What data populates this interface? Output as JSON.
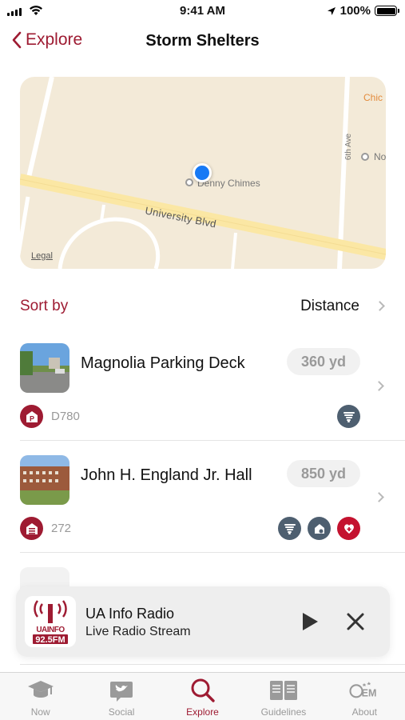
{
  "status_bar": {
    "time": "9:41 AM",
    "battery": "100%"
  },
  "nav": {
    "back_label": "Explore",
    "title": "Storm Shelters"
  },
  "map": {
    "legal": "Legal",
    "street": "University Blvd",
    "poi_label": "Denny Chimes",
    "avenue": "6th Ave",
    "edge_label_top": "Chic",
    "edge_label_right": "No"
  },
  "sort": {
    "label": "Sort by",
    "value": "Distance"
  },
  "shelters": [
    {
      "name": "Magnolia Parking Deck",
      "distance": "360 yd",
      "code": "D780",
      "type_icon": "parking-icon",
      "tags": [
        "tornado-icon"
      ]
    },
    {
      "name": "John H. England Jr. Hall",
      "distance": "850 yd",
      "code": "272",
      "type_icon": "building-icon",
      "tags": [
        "tornado-icon",
        "shelter-home-icon",
        "heart-health-icon"
      ]
    }
  ],
  "player": {
    "title": "UA Info Radio",
    "subtitle": "Live Radio Stream",
    "logo_text": "UAINFO",
    "logo_freq": "92.5FM"
  },
  "tabs": [
    {
      "label": "Now",
      "icon": "graduation-cap-icon"
    },
    {
      "label": "Social",
      "icon": "social-bird-icon"
    },
    {
      "label": "Explore",
      "icon": "search-icon",
      "active": true
    },
    {
      "label": "Guidelines",
      "icon": "book-icon"
    },
    {
      "label": "About",
      "icon": "oem-logo-icon"
    }
  ],
  "colors": {
    "accent": "#9e1b32",
    "tag_slate": "#4e5f70",
    "tag_red": "#c4122f",
    "location_blue": "#1679f5"
  }
}
